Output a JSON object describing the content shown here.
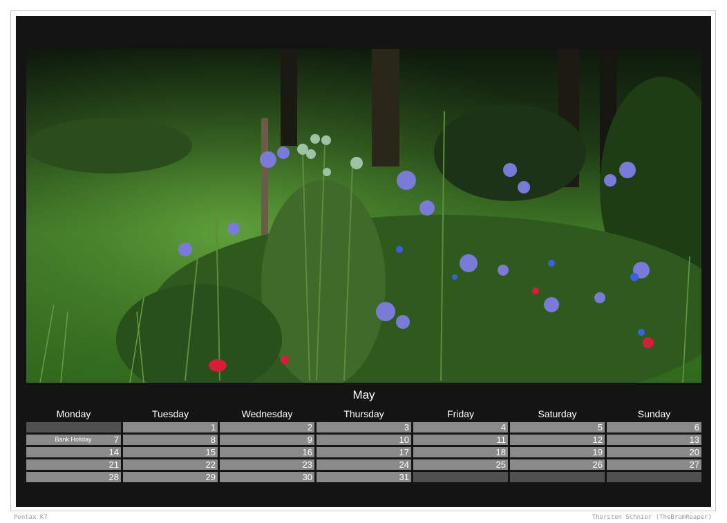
{
  "calendar": {
    "month": "May",
    "weekdays": [
      "Monday",
      "Tuesday",
      "Wednesday",
      "Thursday",
      "Friday",
      "Saturday",
      "Sunday"
    ],
    "weeks": [
      [
        {
          "day": "",
          "note": ""
        },
        {
          "day": "1",
          "note": ""
        },
        {
          "day": "2",
          "note": ""
        },
        {
          "day": "3",
          "note": ""
        },
        {
          "day": "4",
          "note": ""
        },
        {
          "day": "5",
          "note": ""
        },
        {
          "day": "6",
          "note": ""
        }
      ],
      [
        {
          "day": "7",
          "note": "Bank Holiday"
        },
        {
          "day": "8",
          "note": ""
        },
        {
          "day": "9",
          "note": ""
        },
        {
          "day": "10",
          "note": ""
        },
        {
          "day": "11",
          "note": ""
        },
        {
          "day": "12",
          "note": ""
        },
        {
          "day": "13",
          "note": ""
        }
      ],
      [
        {
          "day": "14",
          "note": ""
        },
        {
          "day": "15",
          "note": ""
        },
        {
          "day": "16",
          "note": ""
        },
        {
          "day": "17",
          "note": ""
        },
        {
          "day": "18",
          "note": ""
        },
        {
          "day": "19",
          "note": ""
        },
        {
          "day": "20",
          "note": ""
        }
      ],
      [
        {
          "day": "21",
          "note": ""
        },
        {
          "day": "22",
          "note": ""
        },
        {
          "day": "23",
          "note": ""
        },
        {
          "day": "24",
          "note": ""
        },
        {
          "day": "25",
          "note": ""
        },
        {
          "day": "26",
          "note": ""
        },
        {
          "day": "27",
          "note": ""
        }
      ],
      [
        {
          "day": "28",
          "note": ""
        },
        {
          "day": "29",
          "note": ""
        },
        {
          "day": "30",
          "note": ""
        },
        {
          "day": "31",
          "note": ""
        },
        {
          "day": "",
          "note": ""
        },
        {
          "day": "",
          "note": ""
        },
        {
          "day": "",
          "note": ""
        }
      ]
    ]
  },
  "footer": {
    "camera": "Pentax K7",
    "author": "Thorsten Schnier (TheBrumReaper)"
  },
  "colors": {
    "panel": "#141414",
    "cell": "#8a8a8a",
    "empty_cell": "#505050"
  }
}
